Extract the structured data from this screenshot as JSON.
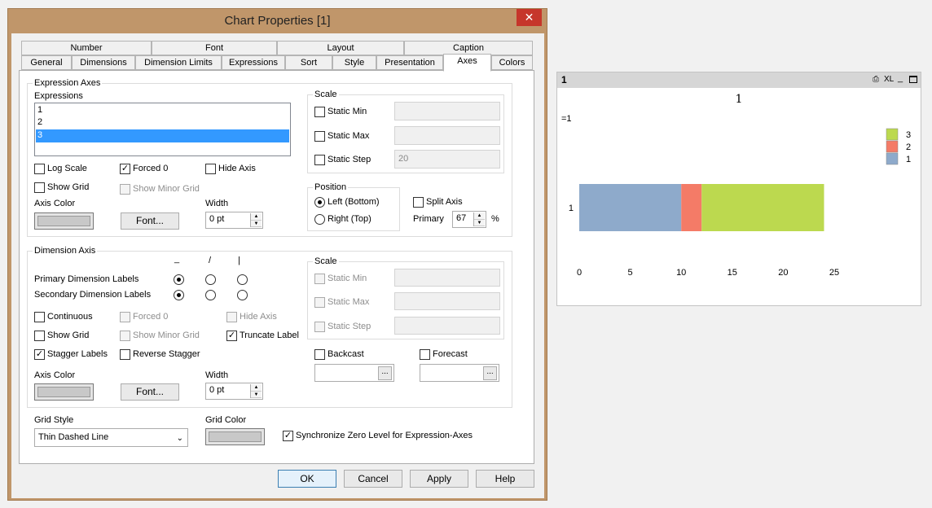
{
  "dialog": {
    "title": "Chart Properties [1]",
    "close": "✕"
  },
  "tabs_row1": [
    "Number",
    "Font",
    "Layout",
    "Caption"
  ],
  "tabs_row2": [
    "General",
    "Dimensions",
    "Dimension Limits",
    "Expressions",
    "Sort",
    "Style",
    "Presentation",
    "Axes",
    "Colors"
  ],
  "expr_axes": {
    "legend": "Expression Axes",
    "expressions_label": "Expressions",
    "list": [
      "1",
      "2",
      "3"
    ],
    "log_scale": "Log Scale",
    "forced0": "Forced 0",
    "hide_axis": "Hide Axis",
    "show_grid": "Show Grid",
    "show_minor_grid": "Show Minor Grid",
    "axis_color": "Axis Color",
    "font_btn": "Font...",
    "width_label": "Width",
    "width_value": "0 pt",
    "scale": {
      "legend": "Scale",
      "static_min": "Static Min",
      "static_max": "Static Max",
      "static_step": "Static Step",
      "step_value": "20"
    },
    "position": {
      "legend": "Position",
      "left": "Left (Bottom)",
      "right": "Right (Top)"
    },
    "split_axis": "Split Axis",
    "primary": "Primary",
    "primary_value": "67",
    "pct": "%"
  },
  "dim_axis": {
    "legend": "Dimension Axis",
    "col_h": "_",
    "col_s": "/",
    "col_v": "|",
    "primary_labels": "Primary Dimension Labels",
    "secondary_labels": "Secondary Dimension Labels",
    "continuous": "Continuous",
    "forced0": "Forced 0",
    "hide_axis": "Hide Axis",
    "show_grid": "Show Grid",
    "show_minor_grid": "Show Minor Grid",
    "truncate_label": "Truncate Label",
    "stagger_labels": "Stagger Labels",
    "reverse_stagger": "Reverse Stagger",
    "axis_color": "Axis Color",
    "font_btn": "Font...",
    "width_label": "Width",
    "width_value": "0 pt",
    "scale": {
      "legend": "Scale",
      "static_min": "Static Min",
      "static_max": "Static Max",
      "static_step": "Static Step"
    },
    "backcast": "Backcast",
    "forecast": "Forecast",
    "browse": "..."
  },
  "grid_style": {
    "label": "Grid Style",
    "value": "Thin Dashed Line"
  },
  "grid_color": {
    "label": "Grid Color"
  },
  "sync_zero": "Synchronize Zero Level for Expression-Axes",
  "buttons": {
    "ok": "OK",
    "cancel": "Cancel",
    "apply": "Apply",
    "help": "Help"
  },
  "chart_window": {
    "caption": "1",
    "icons": [
      "print-icon",
      "xl-icon",
      "minimize-icon",
      "maximize-icon"
    ],
    "xl": "XL",
    "title": "1",
    "expr_label": "=1"
  },
  "chart_data": {
    "type": "bar",
    "orientation": "horizontal",
    "stacked": true,
    "title": "1",
    "categories": [
      "1"
    ],
    "series": [
      {
        "name": "1",
        "values": [
          10
        ],
        "color": "#8eaacb"
      },
      {
        "name": "2",
        "values": [
          2
        ],
        "color": "#f47b67"
      },
      {
        "name": "3",
        "values": [
          12
        ],
        "color": "#bcd94f"
      }
    ],
    "xlim": [
      0,
      25
    ],
    "xticks": [
      "0",
      "5",
      "10",
      "15",
      "20",
      "25"
    ],
    "legend": "top-right"
  }
}
